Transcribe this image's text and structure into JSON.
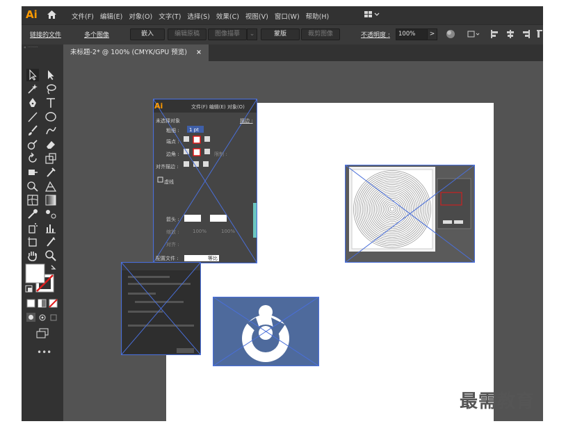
{
  "menubar": {
    "logo": "Ai",
    "menus": [
      "文件(F)",
      "编辑(E)",
      "对象(O)",
      "文字(T)",
      "选择(S)",
      "效果(C)",
      "视图(V)",
      "窗口(W)",
      "帮助(H)"
    ],
    "workspace_icon": "grid-icon",
    "workspace_caret": "⌄"
  },
  "controlbar": {
    "linked_file": "链接的文件",
    "multiple_images": "多个图像",
    "embed": "嵌入",
    "edit_original": "编辑原稿",
    "image_trace": "图像描摹",
    "mask": "蒙版",
    "crop_image": "裁剪图像",
    "opacity_label": "不透明度 :",
    "opacity_value": "100%",
    "arrow": ">"
  },
  "document_tab": {
    "title": "未标题-2* @ 100% (CMYK/GPU 预览)",
    "close": "×"
  },
  "panel_screenshot": {
    "logo": "Ai",
    "menus": "文件(F)  编辑(E)  对象(O)",
    "no_selection": "未选择对象",
    "stroke_label": "描边 :",
    "weight_label": "粗细 :",
    "cap_label": "端点 :",
    "corner_label": "边角 :",
    "limit_label": "限制 :",
    "align_label": "对齐描边 :",
    "dashed": "虚线",
    "arrow_label": "箭头 :",
    "scale_label": "缩放 :",
    "align2_label": "对齐 :",
    "profile_label": "配置文件 :",
    "profile_value": "等比",
    "pct1": "100%",
    "pct2": "100%",
    "weight_value": "1 pt"
  },
  "watermark": "最需教育",
  "colors": {
    "app_bg": "#535353",
    "panel_dark": "#323232",
    "selection_blue": "#4a6fd9",
    "logo_tile": "#4e6a9c",
    "ai_orange": "#ff9a00"
  }
}
